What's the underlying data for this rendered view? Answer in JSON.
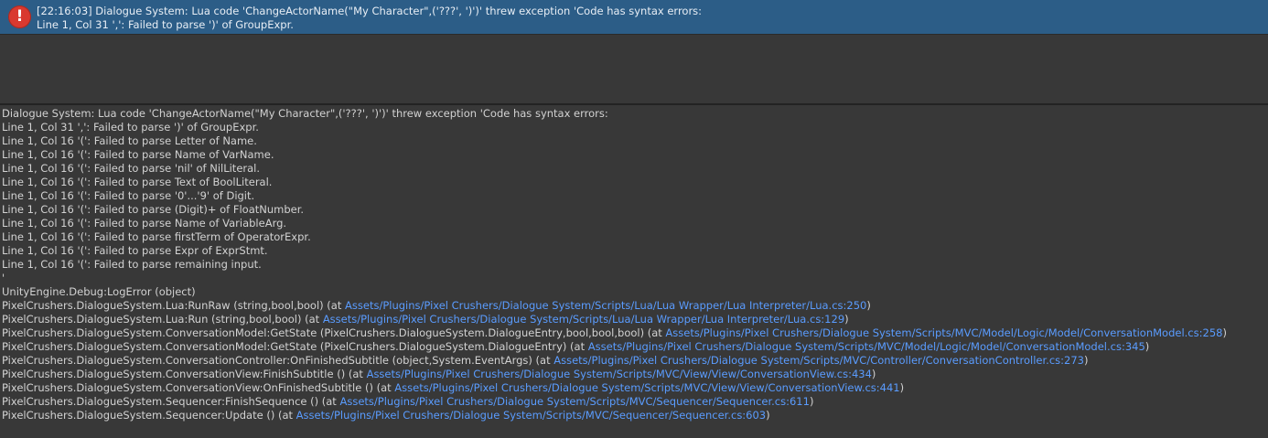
{
  "selected_entry": {
    "icon": "error-icon",
    "line1": "[22:16:03] Dialogue System: Lua code 'ChangeActorName(\"My Character\",('???', ')')' threw exception 'Code has syntax errors:",
    "line2": "Line 1, Col 31 ',': Failed to parse ')' of GroupExpr."
  },
  "details": {
    "message_lines": [
      "Dialogue System: Lua code 'ChangeActorName(\"My Character\",('???', ')')' threw exception 'Code has syntax errors:",
      "Line 1, Col 31 ',': Failed to parse ')' of GroupExpr.",
      "Line 1, Col 16 '(': Failed to parse Letter of Name.",
      "Line 1, Col 16 '(': Failed to parse Name of VarName.",
      "Line 1, Col 16 '(': Failed to parse 'nil' of NilLiteral.",
      "Line 1, Col 16 '(': Failed to parse Text of BoolLiteral.",
      "Line 1, Col 16 '(': Failed to parse '0'...'9' of Digit.",
      "Line 1, Col 16 '(': Failed to parse (Digit)+ of FloatNumber.",
      "Line 1, Col 16 '(': Failed to parse Name of VariableArg.",
      "Line 1, Col 16 '(': Failed to parse firstTerm of OperatorExpr.",
      "Line 1, Col 16 '(': Failed to parse Expr of ExprStmt.",
      "Line 1, Col 16 '(': Failed to parse remaining input.",
      "'"
    ],
    "stack_header": "UnityEngine.Debug:LogError (object)",
    "stack": [
      {
        "prefix": "PixelCrushers.DialogueSystem.Lua:RunRaw (string,bool,bool) (at ",
        "link": "Assets/Plugins/Pixel Crushers/Dialogue System/Scripts/Lua/Lua Wrapper/Lua Interpreter/Lua.cs:250",
        "suffix": ")"
      },
      {
        "prefix": "PixelCrushers.DialogueSystem.Lua:Run (string,bool,bool) (at ",
        "link": "Assets/Plugins/Pixel Crushers/Dialogue System/Scripts/Lua/Lua Wrapper/Lua Interpreter/Lua.cs:129",
        "suffix": ")"
      },
      {
        "prefix": "PixelCrushers.DialogueSystem.ConversationModel:GetState (PixelCrushers.DialogueSystem.DialogueEntry,bool,bool,bool) (at ",
        "link": "Assets/Plugins/Pixel Crushers/Dialogue System/Scripts/MVC/Model/Logic/Model/ConversationModel.cs:258",
        "suffix": ")"
      },
      {
        "prefix": "PixelCrushers.DialogueSystem.ConversationModel:GetState (PixelCrushers.DialogueSystem.DialogueEntry) (at ",
        "link": "Assets/Plugins/Pixel Crushers/Dialogue System/Scripts/MVC/Model/Logic/Model/ConversationModel.cs:345",
        "suffix": ")"
      },
      {
        "prefix": "PixelCrushers.DialogueSystem.ConversationController:OnFinishedSubtitle (object,System.EventArgs) (at ",
        "link": "Assets/Plugins/Pixel Crushers/Dialogue System/Scripts/MVC/Controller/ConversationController.cs:273",
        "suffix": ")"
      },
      {
        "prefix": "PixelCrushers.DialogueSystem.ConversationView:FinishSubtitle () (at ",
        "link": "Assets/Plugins/Pixel Crushers/Dialogue System/Scripts/MVC/View/View/ConversationView.cs:434",
        "suffix": ")"
      },
      {
        "prefix": "PixelCrushers.DialogueSystem.ConversationView:OnFinishedSubtitle () (at ",
        "link": "Assets/Plugins/Pixel Crushers/Dialogue System/Scripts/MVC/View/View/ConversationView.cs:441",
        "suffix": ")"
      },
      {
        "prefix": "PixelCrushers.DialogueSystem.Sequencer:FinishSequence () (at ",
        "link": "Assets/Plugins/Pixel Crushers/Dialogue System/Scripts/MVC/Sequencer/Sequencer.cs:611",
        "suffix": ")"
      },
      {
        "prefix": "PixelCrushers.DialogueSystem.Sequencer:Update () (at ",
        "link": "Assets/Plugins/Pixel Crushers/Dialogue System/Scripts/MVC/Sequencer/Sequencer.cs:603",
        "suffix": ")"
      }
    ]
  },
  "colors": {
    "background": "#383838",
    "selected_row": "#2c5d87",
    "error_icon": "#d9392f",
    "link": "#5a9cff"
  }
}
